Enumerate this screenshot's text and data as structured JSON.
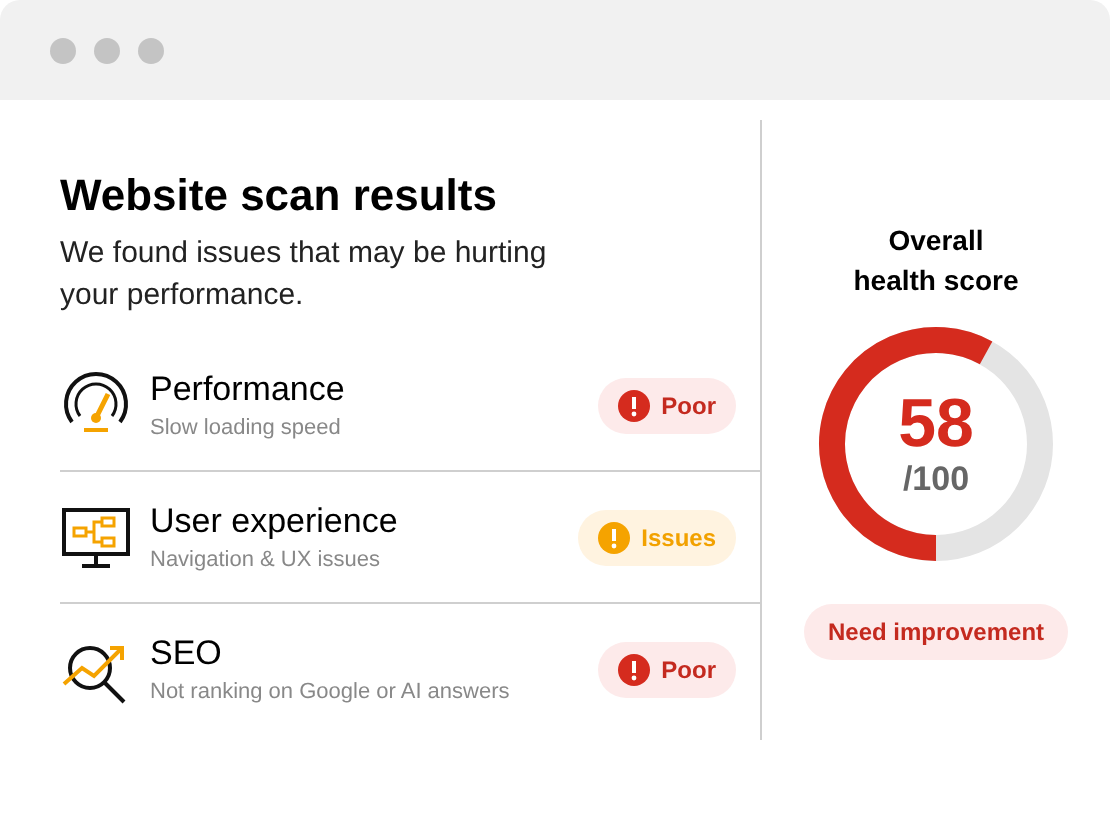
{
  "title": "Website scan results",
  "subtitle": "We found issues that may be hurting your performance.",
  "checks": [
    {
      "kind": "gauge",
      "name": "Performance",
      "detail": "Slow loading speed",
      "status": {
        "kind": "poor",
        "label": "Poor"
      }
    },
    {
      "kind": "monitor",
      "name": "User experience",
      "detail": "Navigation & UX issues",
      "status": {
        "kind": "issues",
        "label": "Issues"
      }
    },
    {
      "kind": "seo",
      "name": "SEO",
      "detail": "Not ranking on Google or AI answers",
      "status": {
        "kind": "poor",
        "label": "Poor"
      }
    }
  ],
  "score": {
    "heading": "Overall health score",
    "value": "58",
    "max": "/100",
    "rating": "Need improvement"
  }
}
